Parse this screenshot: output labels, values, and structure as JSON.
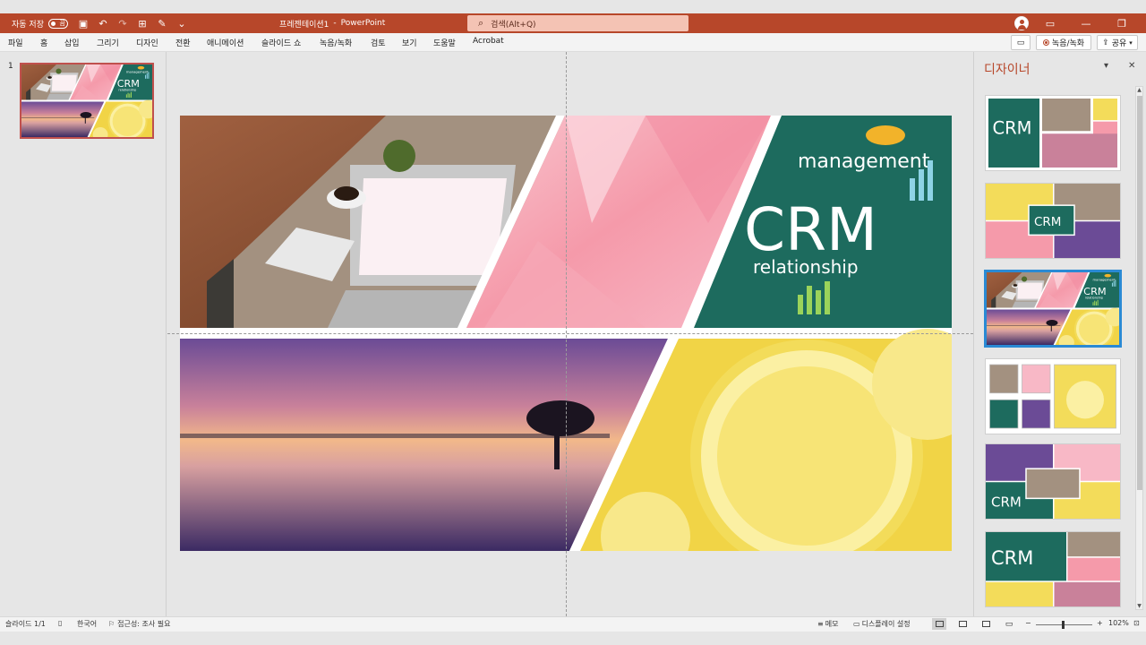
{
  "titlebar": {
    "autosave_label": "자동 저장",
    "toggle_state": "끔",
    "document_title": "프레젠테이션1",
    "separator": "-",
    "app_name": "PowerPoint",
    "search_placeholder": "검색(Alt+Q)"
  },
  "menu": {
    "items": [
      "파일",
      "홈",
      "삽입",
      "그리기",
      "디자인",
      "전환",
      "애니메이션",
      "슬라이드 쇼",
      "녹음/녹화",
      "검토",
      "보기",
      "도움말",
      "Acrobat"
    ],
    "record_button": "녹음/녹화",
    "share_button": "공유"
  },
  "thumbnails": {
    "slide_number": "1"
  },
  "designer": {
    "title": "디자이너",
    "selected_index": 2
  },
  "status": {
    "slide_info": "슬라이드 1/1",
    "language": "한국어",
    "accessibility": "접근성: 조사 필요",
    "notes": "메모",
    "display_settings": "디스플레이 설정",
    "zoom": "102%"
  },
  "colors": {
    "accent": "#b7472a",
    "designer_selected": "#2a8ad4"
  }
}
